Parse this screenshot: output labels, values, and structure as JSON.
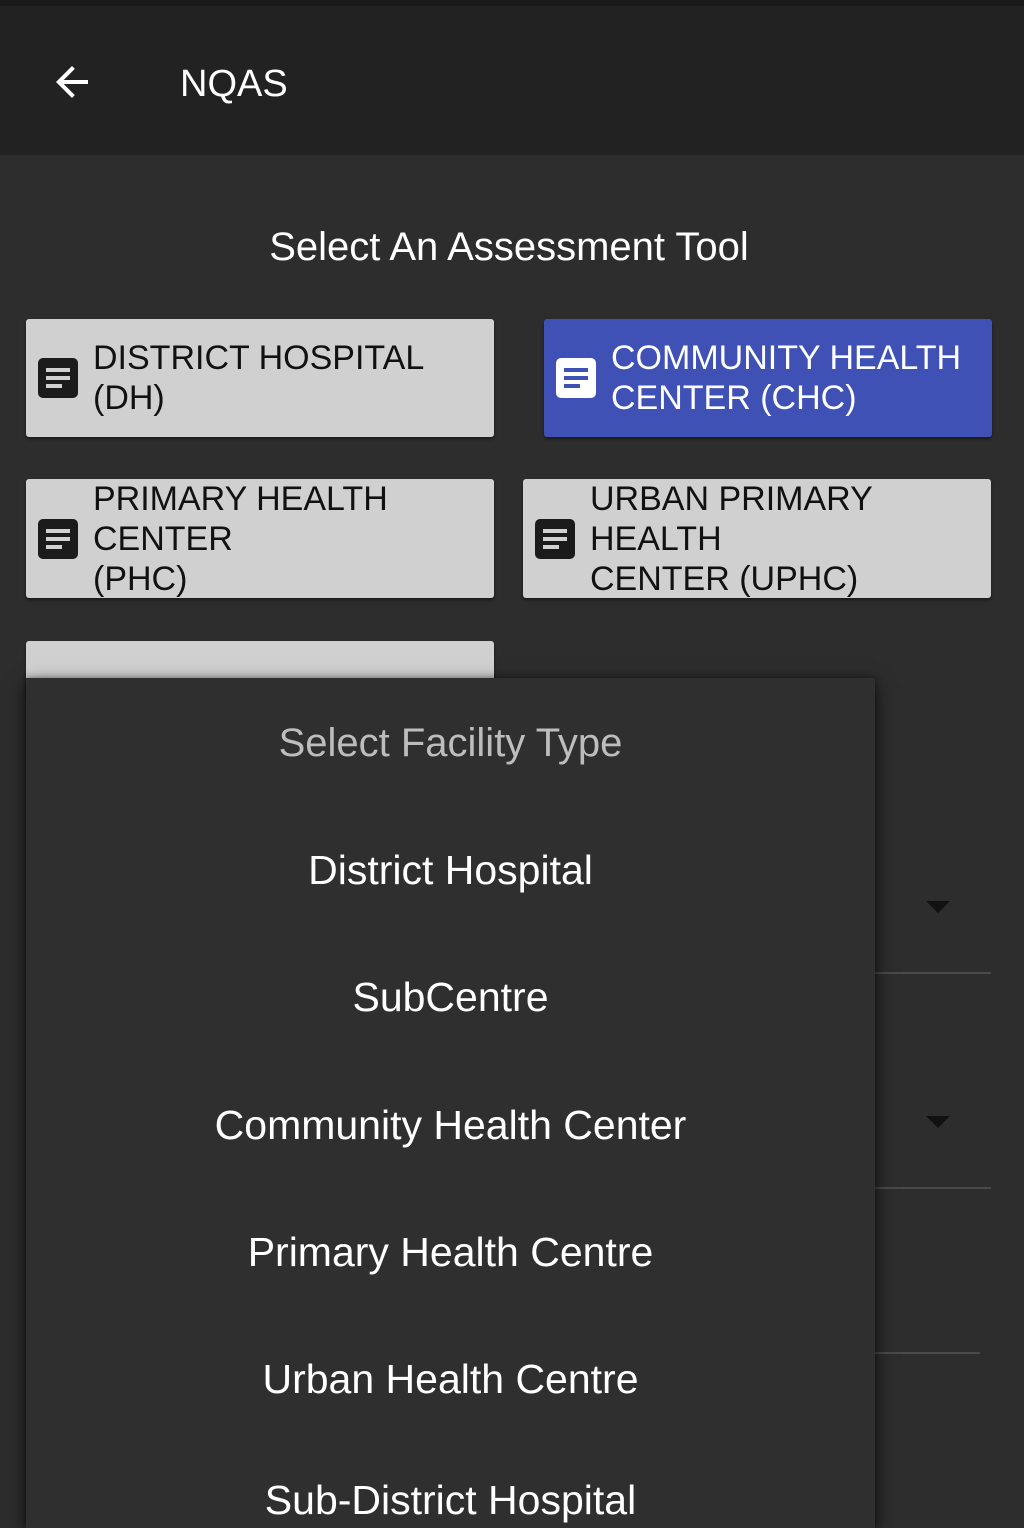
{
  "appbar": {
    "title": "NQAS",
    "back_icon": "arrow-left-icon"
  },
  "screen": {
    "heading": "Select An Assessment Tool"
  },
  "tools": [
    {
      "label": "DISTRICT HOSPITAL (DH)",
      "icon": "document-icon",
      "selected": false
    },
    {
      "label": "COMMUNITY HEALTH\nCENTER (CHC)",
      "icon": "document-icon",
      "selected": true
    },
    {
      "label": "PRIMARY HEALTH CENTER\n(PHC)",
      "icon": "document-icon",
      "selected": false
    },
    {
      "label": "URBAN PRIMARY HEALTH\nCENTER (UPHC)",
      "icon": "document-icon",
      "selected": false
    }
  ],
  "facility_menu": {
    "header": "Select Facility Type",
    "options": [
      "District Hospital",
      "SubCentre",
      "Community Health Center",
      "Primary Health Centre",
      "Urban Health Centre",
      "Sub-District Hospital"
    ]
  },
  "colors": {
    "background": "#2d2d2d",
    "appbar": "#222222",
    "button": "#d0d0d0",
    "selected_button": "#3f51b5",
    "menu": "#2f2f2f"
  }
}
